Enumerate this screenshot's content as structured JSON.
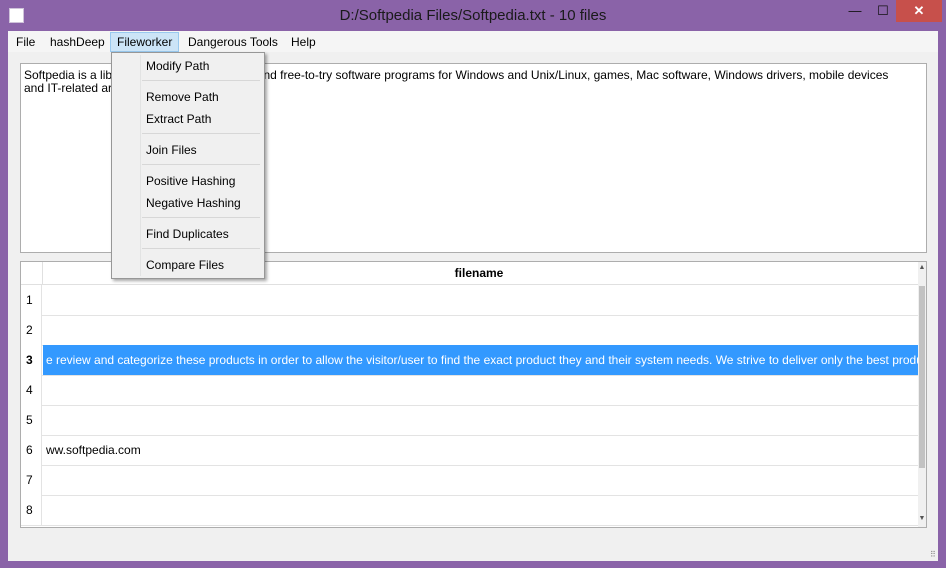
{
  "window": {
    "title": "D:/Softpedia Files/Softpedia.txt - 10 files",
    "minimize_glyph": "—",
    "maximize_glyph": "☐",
    "close_glyph": "✕"
  },
  "menubar": {
    "file": "File",
    "hashdeep": "hashDeep",
    "fileworker": "Fileworker",
    "dangerous_tools": "Dangerous Tools",
    "help": "Help"
  },
  "fileworker_menu": {
    "modify_path": "Modify Path",
    "remove_path": "Remove Path",
    "extract_path": "Extract Path",
    "join_files": "Join Files",
    "positive_hashing": "Positive Hashing",
    "negative_hashing": "Negative Hashing",
    "find_duplicates": "Find Duplicates",
    "compare_files": "Compare Files"
  },
  "textbox": {
    "content": "Softpedia is a library of over 1,000,000 free and free-to-try software programs for Windows and Unix/Linux, games, Mac software, Windows drivers, mobile devices and IT-related articles."
  },
  "table": {
    "column_header": "filename",
    "rows": [
      {
        "num": "1",
        "value": ""
      },
      {
        "num": "2",
        "value": ""
      },
      {
        "num": "3",
        "value": "e review and categorize these products in order to allow the visitor/user to find the exact product they and their system needs. We strive to deliver only the best produc"
      },
      {
        "num": "4",
        "value": ""
      },
      {
        "num": "5",
        "value": ""
      },
      {
        "num": "6",
        "value": "ww.softpedia.com"
      },
      {
        "num": "7",
        "value": ""
      },
      {
        "num": "8",
        "value": ""
      }
    ]
  },
  "colors": {
    "window_frame": "#8a63a8",
    "close_button": "#c7504b",
    "selection": "#3399ff"
  }
}
